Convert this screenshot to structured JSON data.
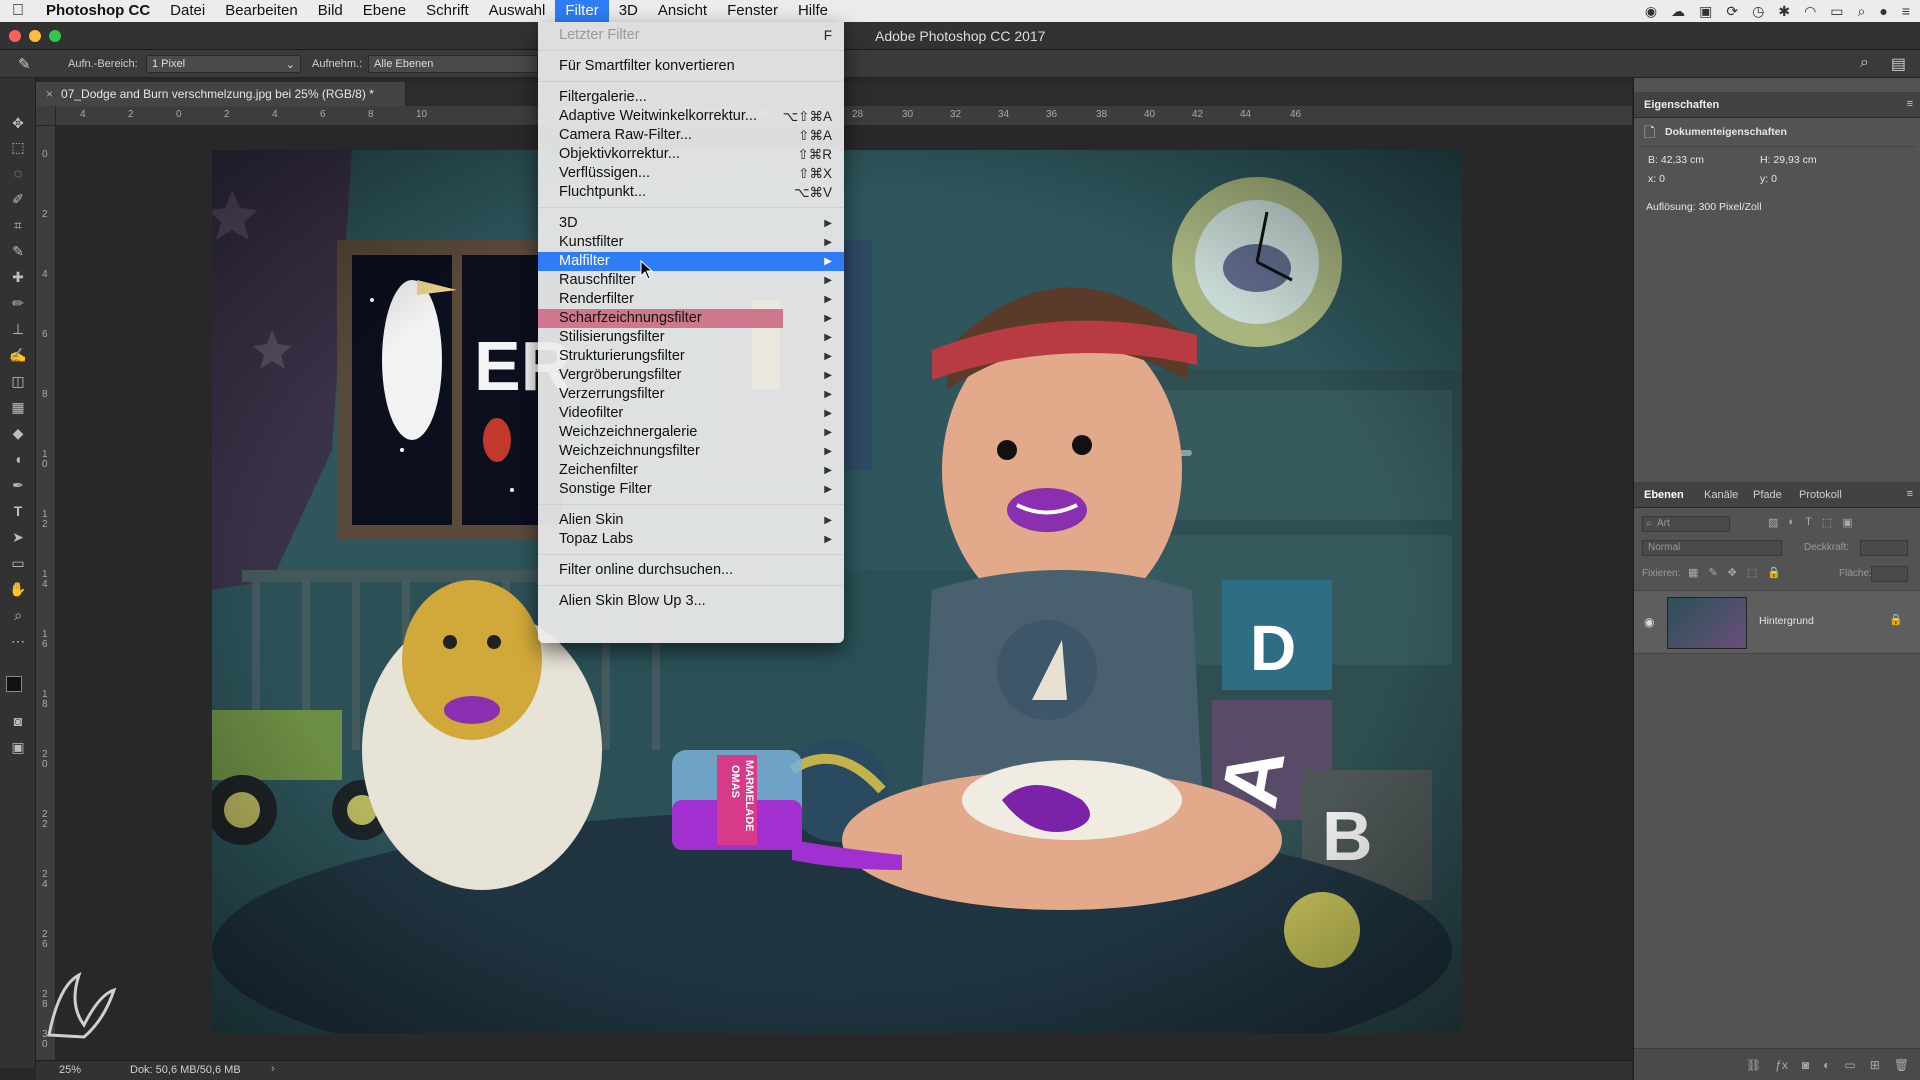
{
  "menubar": {
    "app": "Photoshop CC",
    "items": [
      "Datei",
      "Bearbeiten",
      "Bild",
      "Ebene",
      "Schrift",
      "Auswahl",
      "Filter",
      "3D",
      "Ansicht",
      "Fenster",
      "Hilfe"
    ],
    "active_item": "Filter"
  },
  "window": {
    "title": "Adobe Photoshop CC 2017"
  },
  "options_bar": {
    "area_label": "Aufn.-Bereich:",
    "area_value": "1 Pixel",
    "sample_label": "Aufnehm.:",
    "sample_value": "Alle Ebenen"
  },
  "document": {
    "tab_title": "07_Dodge and Burn verschmelzung.jpg bei 25% (RGB/8) *",
    "zoom": "25%",
    "doc_info": "Dok: 50,6 MB/50,6 MB"
  },
  "rulers": {
    "horizontal": [
      "4",
      "2",
      "0",
      "2",
      "4",
      "6",
      "8",
      "10",
      "22",
      "24",
      "26",
      "28",
      "30",
      "32",
      "34",
      "36",
      "38",
      "40",
      "42",
      "44",
      "46"
    ],
    "vertical": [
      "0",
      "2",
      "4",
      "6",
      "8",
      "1\n0",
      "1\n2",
      "1\n4",
      "1\n6",
      "1\n8",
      "2\n0",
      "2\n2",
      "2\n4",
      "2\n6",
      "2\n8",
      "3\n0"
    ]
  },
  "filter_menu": {
    "items": [
      {
        "label": "Letzter Filter",
        "shortcut": "F",
        "disabled": true
      },
      {
        "sep": true
      },
      {
        "label": "Für Smartfilter konvertieren"
      },
      {
        "sep": true
      },
      {
        "label": "Filtergalerie..."
      },
      {
        "label": "Adaptive Weitwinkelkorrektur...",
        "shortcut": "⌥⇧⌘A"
      },
      {
        "label": "Camera Raw-Filter...",
        "shortcut": "⇧⌘A"
      },
      {
        "label": "Objektivkorrektur...",
        "shortcut": "⇧⌘R"
      },
      {
        "label": "Verflüssigen...",
        "shortcut": "⇧⌘X"
      },
      {
        "label": "Fluchtpunkt...",
        "shortcut": "⌥⌘V"
      },
      {
        "sep": true
      },
      {
        "label": "3D",
        "submenu": true
      },
      {
        "label": "Kunstfilter",
        "submenu": true
      },
      {
        "label": "Malfilter",
        "submenu": true,
        "highlighted": true
      },
      {
        "label": "Rauschfilter",
        "submenu": true
      },
      {
        "label": "Renderfilter",
        "submenu": true
      },
      {
        "label": "Scharfzeichnungsfilter",
        "submenu": true,
        "pink": true
      },
      {
        "label": "Stilisierungsfilter",
        "submenu": true
      },
      {
        "label": "Strukturierungsfilter",
        "submenu": true
      },
      {
        "label": "Vergröberungsfilter",
        "submenu": true
      },
      {
        "label": "Verzerrungsfilter",
        "submenu": true
      },
      {
        "label": "Videofilter",
        "submenu": true
      },
      {
        "label": "Weichzeichnergalerie",
        "submenu": true
      },
      {
        "label": "Weichzeichnungsfilter",
        "submenu": true
      },
      {
        "label": "Zeichenfilter",
        "submenu": true
      },
      {
        "label": "Sonstige Filter",
        "submenu": true
      },
      {
        "sep": true
      },
      {
        "label": "Alien Skin",
        "submenu": true
      },
      {
        "label": "Topaz Labs",
        "submenu": true
      },
      {
        "sep": true
      },
      {
        "label": "Filter online durchsuchen..."
      },
      {
        "sep": true
      },
      {
        "label": "Alien Skin Blow Up 3..."
      }
    ]
  },
  "properties_panel": {
    "title": "Eigenschaften",
    "subtitle": "Dokumenteigenschaften",
    "width": "B: 42,33 cm",
    "height": "H: 29,93 cm",
    "x": "x: 0",
    "y": "y: 0",
    "resolution": "Auflösung: 300 Pixel/Zoll"
  },
  "layers_panel": {
    "tabs": [
      "Ebenen",
      "Kanäle",
      "Pfade",
      "Protokoll"
    ],
    "active_tab": "Ebenen",
    "search_placeholder": "Art",
    "blend_mode": "Normal",
    "opacity_label": "Deckkraft:",
    "lock_label": "Fixieren:",
    "fill_label": "Fläche:",
    "layer_name": "Hintergrund"
  },
  "artwork": {
    "jar_label_line1": "OMAS",
    "jar_label_line2": "MARMELADE",
    "block_letters": [
      "D",
      "A",
      "B"
    ],
    "window_letters": "ER"
  },
  "colors": {
    "menu_highlight": "#2e7cf6",
    "pink_highlight": "#cb6580"
  }
}
